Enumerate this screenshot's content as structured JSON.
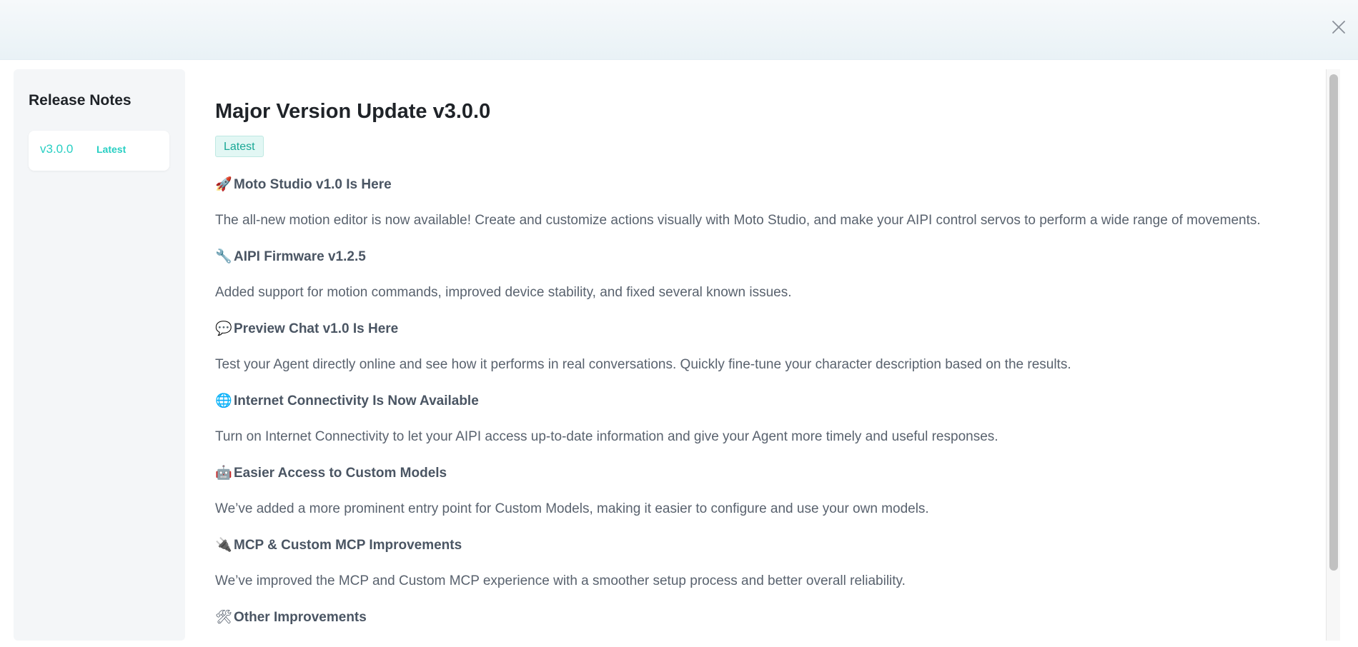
{
  "header": {
    "close_icon": "close-icon"
  },
  "sidebar": {
    "title": "Release Notes",
    "items": [
      {
        "version": "v3.0.0",
        "tag": "Latest"
      }
    ]
  },
  "main": {
    "title": "Major Version Update v3.0.0",
    "badge": "Latest",
    "sections": [
      {
        "icon": "🚀",
        "heading": "Moto Studio v1.0 Is Here",
        "body": "The all-new motion editor is now available! Create and customize actions visually with Moto Studio, and make your AIPI control servos to perform a wide range of movements."
      },
      {
        "icon": "🔧",
        "heading": "AIPI Firmware v1.2.5",
        "body": "Added support for motion commands, improved device stability, and fixed several known issues."
      },
      {
        "icon": "💬",
        "heading": "Preview Chat v1.0 Is Here",
        "body": "Test your Agent directly online and see how it performs in real conversations. Quickly fine-tune your character description based on the results."
      },
      {
        "icon": "🌐",
        "heading": "Internet Connectivity Is Now Available",
        "body": "Turn on Internet Connectivity to let your AIPI access up-to-date information and give your Agent more timely and useful responses."
      },
      {
        "icon": "🤖",
        "heading": "Easier Access to Custom Models",
        "body": "We’ve added a more prominent entry point for Custom Models, making it easier to configure and use your own models."
      },
      {
        "icon": "🔌",
        "heading": "MCP & Custom MCP Improvements",
        "body": "We’ve improved the MCP and Custom MCP experience with a smoother setup process and better overall reliability."
      },
      {
        "icon": "🛠",
        "heading": "Other Improvements",
        "body": ""
      }
    ]
  },
  "colors": {
    "accent": "#27cfc3",
    "badge_bg": "#e2f7f4",
    "title": "#1f2328",
    "heading": "#4a5563",
    "body": "#59626e"
  }
}
